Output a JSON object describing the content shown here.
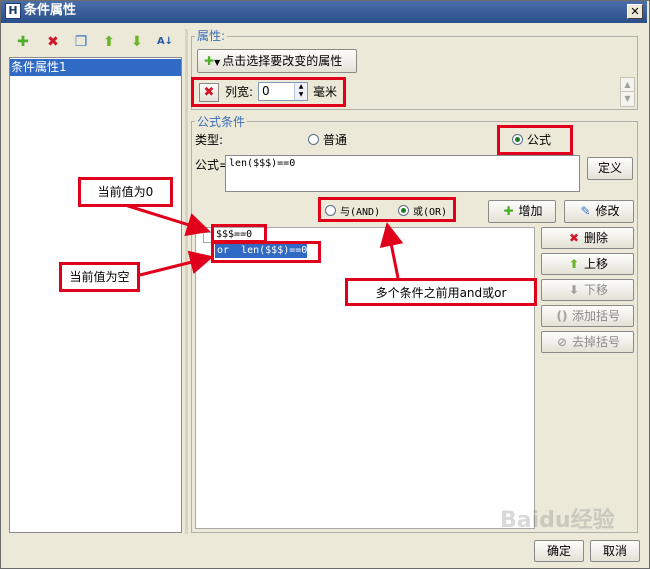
{
  "window": {
    "title": "条件属性",
    "title_icon": "H",
    "close_glyph": "✕"
  },
  "toolbar": {
    "icons": [
      {
        "name": "add-icon",
        "glyph": "✚",
        "color": "#4caf2a"
      },
      {
        "name": "delete-icon",
        "glyph": "✖",
        "color": "#d0182a"
      },
      {
        "name": "copy-icon",
        "glyph": "❐",
        "color": "#3a78c8"
      },
      {
        "name": "move-up-icon",
        "glyph": "⬆",
        "color": "#6ab52a"
      },
      {
        "name": "move-down-icon",
        "glyph": "⬇",
        "color": "#6ab52a"
      },
      {
        "name": "sort-az-icon",
        "glyph": "A↓",
        "color": "#2a5aa8"
      }
    ]
  },
  "condition_list": {
    "items": [
      "条件属性1"
    ]
  },
  "attr_group": {
    "title": "属性:",
    "choose_label": "点击选择要改变的属性",
    "column_width_label": "列宽:",
    "column_width_value": "0",
    "unit": "毫米"
  },
  "formula_group": {
    "title": "公式条件",
    "type_label": "类型:",
    "radio_normal": "普通",
    "radio_formula": "公式",
    "formula_label": "公式=",
    "formula_value": "len($$$)==0",
    "define_button": "定义"
  },
  "logic": {
    "and_label": "与(AND)",
    "or_label": "或(OR)"
  },
  "conditions": [
    {
      "text": "$$$==0",
      "selected": false
    },
    {
      "text": "or  len($$$)==0",
      "selected": true
    }
  ],
  "buttons": {
    "add": "增加",
    "edit": "修改",
    "delete": "删除",
    "move_up": "上移",
    "move_down": "下移",
    "add_paren": "添加括号",
    "remove_paren": "去掉括号",
    "ok": "确定",
    "cancel": "取消"
  },
  "annotations": {
    "current_zero": "当前值为0",
    "current_empty": "当前值为空",
    "multi_condition": "多个条件之前用and或or"
  },
  "watermark": "Baidu经验",
  "colors": {
    "annotation_red": "#e0001b",
    "selection_blue": "#316ac5",
    "group_title_blue": "#3a6fb5"
  }
}
